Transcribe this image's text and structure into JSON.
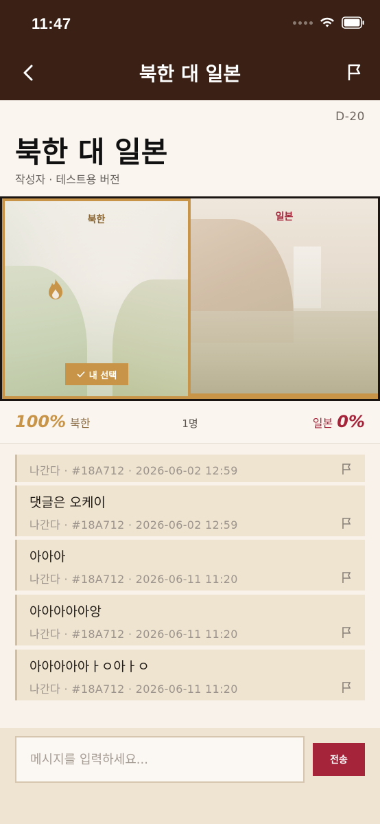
{
  "status_bar": {
    "time": "11:47"
  },
  "header": {
    "title": "북한 대 일본"
  },
  "post": {
    "dday": "D-20",
    "title": "북한 대 일본",
    "meta": "작성자 · 테스트용 버전"
  },
  "vote": {
    "left_label": "북한",
    "right_label": "일본",
    "my_choice_label": "내 선택",
    "selected_side": "left"
  },
  "result": {
    "left_percent": "100%",
    "left_label": "북한",
    "count": "1명",
    "right_label": "일본",
    "right_percent": "0%"
  },
  "comments": [
    {
      "text": "",
      "author": "나간다",
      "id": "#18A712",
      "time": "2026-06-02 12:59"
    },
    {
      "text": "댓글은 오케이",
      "author": "나간다",
      "id": "#18A712",
      "time": "2026-06-02 12:59"
    },
    {
      "text": "아아아",
      "author": "나간다",
      "id": "#18A712",
      "time": "2026-06-11 11:20"
    },
    {
      "text": "아아아아아앙",
      "author": "나간다",
      "id": "#18A712",
      "time": "2026-06-11 11:20"
    },
    {
      "text": "아아아아아ㅏㅇ아ㅏㅇ",
      "author": "나간다",
      "id": "#18A712",
      "time": "2026-06-11 11:20"
    }
  ],
  "input": {
    "placeholder": "메시지를 입력하세요...",
    "send_label": "전송"
  },
  "colors": {
    "header_bg": "#3a2015",
    "accent_gold": "#c89448",
    "accent_red": "#a6243a"
  }
}
